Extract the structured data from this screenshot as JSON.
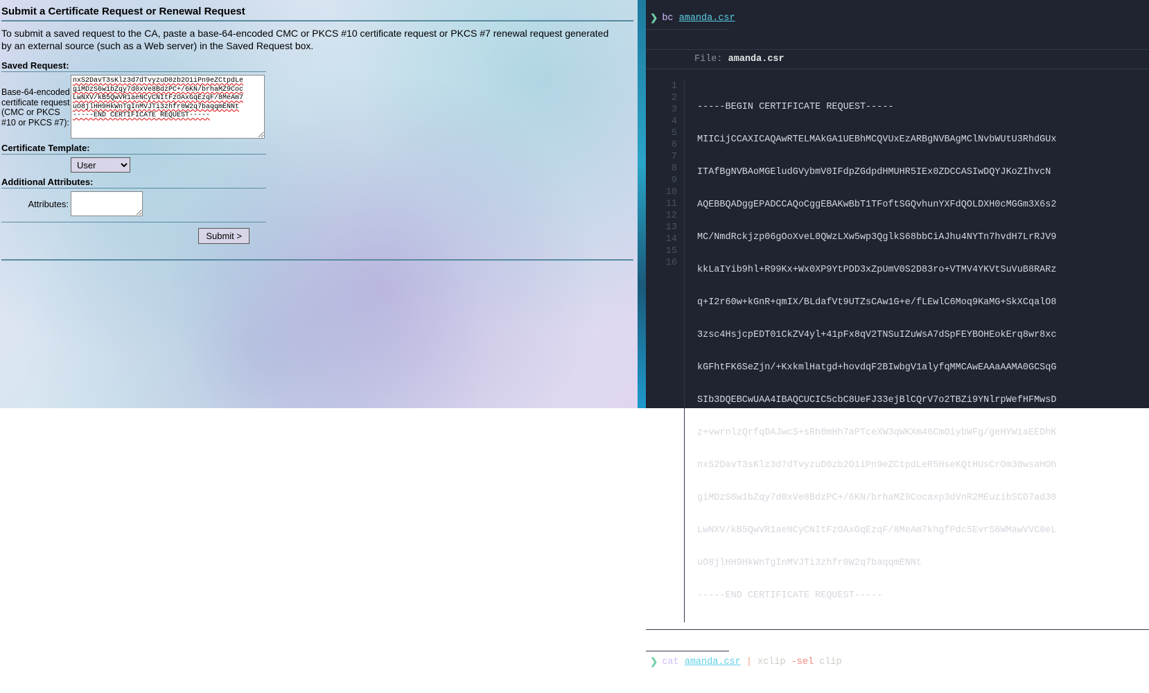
{
  "left": {
    "title": "Submit a Certificate Request or Renewal Request",
    "intro": "To submit a saved request to the CA, paste a base-64-encoded CMC or PKCS #10 certificate request or PKCS #7 renewal request generated by an external source (such as a Web server) in the Saved Request box.",
    "saved_request_label": "Saved Request:",
    "saved_request_caption": "Base-64-encoded certificate request (CMC or PKCS #10 or PKCS #7):",
    "saved_request_value": "nxS2DavT3sKlz3d7dTvyzuD0zb2O1iPn9eZCtpdLe\ngiMDzS6w1bZqy7d0xVe8BdzPC+/6KN/brhaMZ9Coc\nLwNXV/kB5QwVR1aeNCyCNItFzOAxGqEzqF/8MeAm7\nuO8jlHH9HkWnTgInMVJTi3zhfr0W2q7baqqmENNt\n-----END CERTIFICATE REQUEST-----",
    "cert_template_label": "Certificate Template:",
    "cert_template_value": "User",
    "additional_attrs_label": "Additional Attributes:",
    "attributes_label": "Attributes:",
    "attributes_value": "",
    "submit_label": "Submit >"
  },
  "right": {
    "cmd1_prompt": "❯",
    "cmd1_cmd": "bc",
    "cmd1_arg": "amanda.csr",
    "file_label": "File:",
    "file_name": "amanda.csr",
    "lines": [
      "-----BEGIN CERTIFICATE REQUEST-----",
      "MIICijCCAXICAQAwRTELMAkGA1UEBhMCQVUxEzARBgNVBAgMClNvbWUtU3RhdGUx",
      "ITAfBgNVBAoMGEludGVybmV0IFdpZGdpdHMUHR5IEx0ZDCCASIwDQYJKoZIhvcN",
      "AQEBBQADggEPADCCAQoCggEBAKwBbT1TFoftSGQvhunYXFdQOLDXH0cMGGm3X6s2",
      "MC/NmdRckjzp06gOoXveL0QWzLXw5wp3QglkS68bbCiAJhu4NYTn7hvdH7LrRJV9",
      "kkLaIYib9hl+R99Kx+Wx0XP9YtPDD3xZpUmV0S2D83ro+VTMV4YKVtSuVuB8RARz",
      "q+I2r60w+kGnR+qmIX/BLdafVt9UTZsCAw1G+e/fLEwlC6Moq9KaMG+SkXCqalO8",
      "3zsc4HsjcpEDT01CkZV4yl+41pFx8qV2TNSuIZuWsA7dSpFEYBOHEokErq8wr8xc",
      "kGFhtFK6SeZjn/+KxkmlHatgd+hovdqF2BIwbgV1alyfqMMCAwEAAaAAMA0GCSqG",
      "SIb3DQEBCwUAA4IBAQCUCIC5cbC8UeFJ33ejBlCQrV7o2TBZi9YNlrpWefHFMwsD",
      "z+vwrnlzQrfqDAJwcS+sRh0mHh7aPTceXW3qWKXm46CmOiybWFg/geHYW1aEEDhK",
      "nxS2DavT3sKlz3d7dTvyzuD0zb2O1iPn9eZCtpdLeR5HseKQtHUsCrOm30wsaHOh",
      "giMDzS6w1bZqy7d0xVe8BdzPC+/6KN/brhaMZ9Cocaxp3dVnR2MEuzibSCD7ad30",
      "LwNXV/kB5QwVR1aeNCyCNItFzOAxGqEzqF/8MeAm7khgfPdc5EvrS6WMawVVC0eL",
      "uO8jlHH9HkWnTgInMVJTi3zhfr0W2q7baqqmENNt",
      "-----END CERTIFICATE REQUEST-----"
    ],
    "cmd2_prompt": "❯",
    "cmd2_cmd": "cat",
    "cmd2_arg": "amanda.csr",
    "cmd2_pipe": "|",
    "cmd2_cmd2": "xclip",
    "cmd2_flag": "-sel",
    "cmd2_arg2": "clip"
  }
}
